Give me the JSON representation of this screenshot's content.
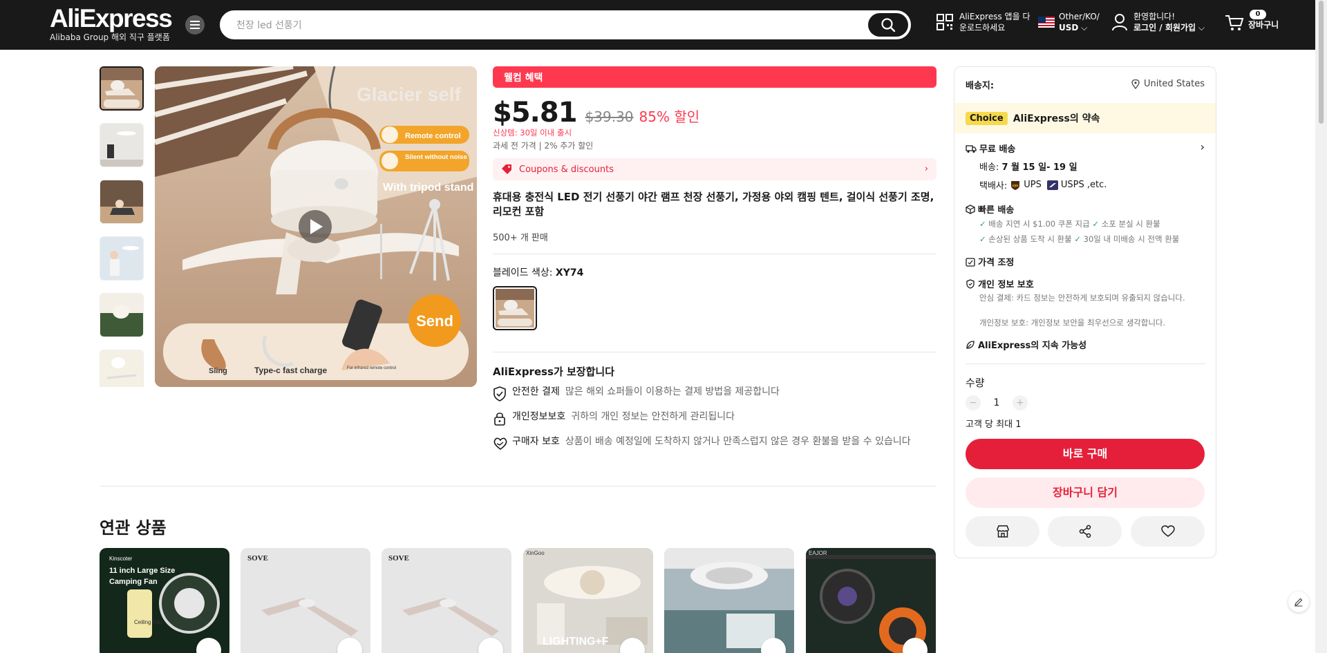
{
  "header": {
    "logo": "AliExpress",
    "tagline": "Alibaba Group 해외 직구 플랫폼",
    "search_placeholder": "천장 led 선풍기",
    "app_line1": "AliExpress 앱을 다",
    "app_line2": "운로드하세요",
    "region_line1": "Other/KO/",
    "region_line2": "USD",
    "account_line1": "환영합니다!",
    "account_line2": "로그인 / 회원가입",
    "cart_count": "0",
    "cart_label": "장바구니"
  },
  "product": {
    "promo": "웰컴 혜택",
    "price": "$5.81",
    "original_price": "$39.30",
    "discount": "85% 할인",
    "new_note": "신상템: 30일 이내 출시",
    "tax_note": "과세 전 가격 | 2% 추가 할인",
    "coupon_label": "Coupons & discounts",
    "title": "휴대용 충전식 LED 전기 선풍기 야간 램프 천장 선풍기, 가정용 야외 캠핑 텐트, 걸이식 선풍기 조명, 리모컨 포함",
    "sold": "500+ 개 판매",
    "color_label": "블레이드 색상: ",
    "color_value": "XY74"
  },
  "main_image_text": {
    "headline": "Glacier self",
    "feature1": "Remote control",
    "feature2": "Silent without noise",
    "tripod": "With tripod stand",
    "send": "Send",
    "sling": "Sling",
    "typec": "Type-c fast charge",
    "infrared": "For infrared remote control"
  },
  "guarantee": {
    "title": "AliExpress가 보장합니다",
    "items": [
      {
        "title": "안전한 결제",
        "desc": "많은 해외 쇼퍼들이 이용하는 결제 방법을 제공합니다"
      },
      {
        "title": "개인정보보호",
        "desc": "귀하의 개인 정보는 안전하게 관리됩니다"
      },
      {
        "title": "구매자 보호",
        "desc": "상품이 배송 예정일에 도착하지 않거나 만족스럽지 않은 경우 환불을 받을 수 있습니다"
      }
    ]
  },
  "related": {
    "title": "연관 상품",
    "cards": [
      {
        "label1": "Kinscoter",
        "label2": "11 inch Large Size",
        "label3": "Camping Fan",
        "label4": "Ceiling Fan"
      },
      {
        "label1": "SOVE"
      },
      {
        "label1": "SOVE"
      },
      {
        "label1": "XinGoo",
        "label2": "LIGHTING+F"
      },
      {
        "label1": ""
      },
      {
        "label1": "EAJOR"
      }
    ]
  },
  "panel": {
    "ship_to_label": "배송지:",
    "ship_to_value": "United States",
    "choice_badge": "Choice",
    "choice_text": "AliExpress의 약속",
    "free_shipping": "무료 배송",
    "delivery_prefix": "배송: ",
    "delivery_dates": "7 월 15 일- 19 일",
    "carrier_prefix": "택배사: ",
    "carrier_ups": "UPS",
    "carrier_usps": "USPS ,etc.",
    "fast_delivery": "빠른 배송",
    "fast1": "배송 지연 시 $1.00 쿠폰 지급",
    "fast2": "소포 분실 시 환불",
    "fast3": "손상된 상품 도착 시 환불",
    "fast4": "30일 내 미배송 시 전액 환불",
    "price_adjust": "가격 조정",
    "privacy": "개인 정보 보호",
    "privacy1": "안심 결제: 카드 정보는 안전하게 보호되며 유출되지 않습니다.",
    "privacy2": "개인정보 보호: 개인정보 보안을 최우선으로 생각합니다.",
    "sustain": "AliExpress의 지속 가능성",
    "qty_label": "수량",
    "qty_minus": "−",
    "qty_value": "1",
    "qty_plus": "+",
    "limit": "고객 당 최대 1",
    "buy_now": "바로 구매",
    "add_to_cart": "장바구니 담기"
  },
  "colors": {
    "header_bg": "#191919",
    "accent_red": "#fd384f",
    "buy_red": "#e51f3a",
    "choice_yellow": "#f7d94c"
  }
}
